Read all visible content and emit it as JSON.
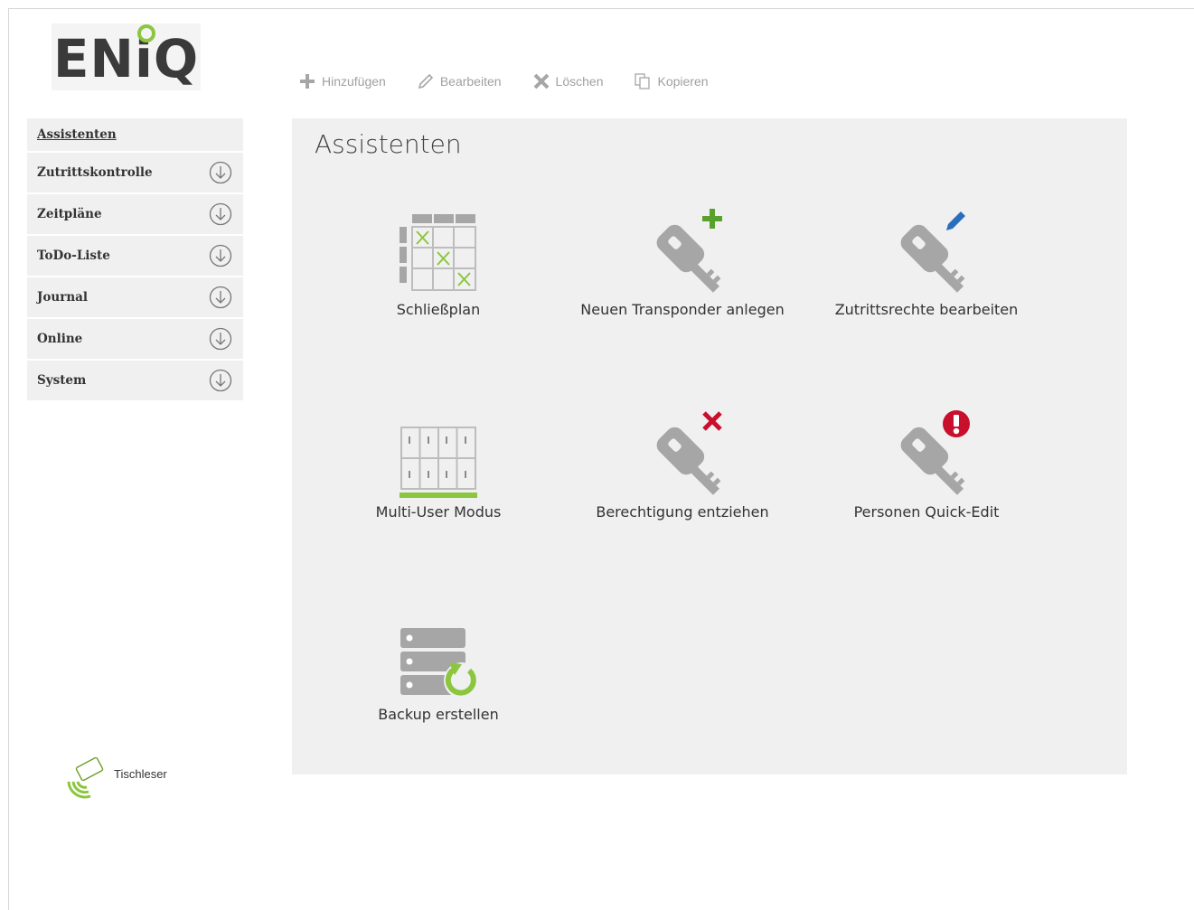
{
  "logo": {
    "text": "ENiQ"
  },
  "toolbar": {
    "add_label": "Hinzufügen",
    "edit_label": "Bearbeiten",
    "delete_label": "Löschen",
    "copy_label": "Kopieren"
  },
  "sidebar": {
    "items": [
      {
        "label": "Assistenten"
      },
      {
        "label": "Zutrittskontrolle",
        "icon": "arrow-down-circle-icon"
      },
      {
        "label": "Zeitpläne",
        "icon": "arrow-down-circle-icon"
      },
      {
        "label": "ToDo-Liste",
        "icon": "arrow-down-circle-icon"
      },
      {
        "label": "Journal",
        "icon": "arrow-down-circle-icon"
      },
      {
        "label": "Online",
        "icon": "arrow-down-circle-icon"
      },
      {
        "label": "System",
        "icon": "arrow-down-circle-icon"
      }
    ]
  },
  "reader": {
    "label": "Tischleser"
  },
  "main": {
    "title": "Assistenten",
    "tiles": [
      {
        "label": "Schließplan",
        "icon": "lock-plan-grid-icon"
      },
      {
        "label": "Neuen Transponder anlegen",
        "icon": "key-add-icon"
      },
      {
        "label": "Zutrittsrechte bearbeiten",
        "icon": "key-edit-icon"
      },
      {
        "label": "Multi-User Modus",
        "icon": "multi-user-cabinet-icon"
      },
      {
        "label": "Berechtigung entziehen",
        "icon": "key-remove-icon"
      },
      {
        "label": "Personen Quick-Edit",
        "icon": "key-alert-icon"
      },
      {
        "label": "Backup erstellen",
        "icon": "server-backup-icon"
      }
    ]
  },
  "colors": {
    "accent_green": "#8cc63f",
    "panel_bg": "#f0f0f0",
    "icon_grey": "#a6a6a6",
    "red": "#c8102e",
    "blue": "#2a6ebb"
  }
}
